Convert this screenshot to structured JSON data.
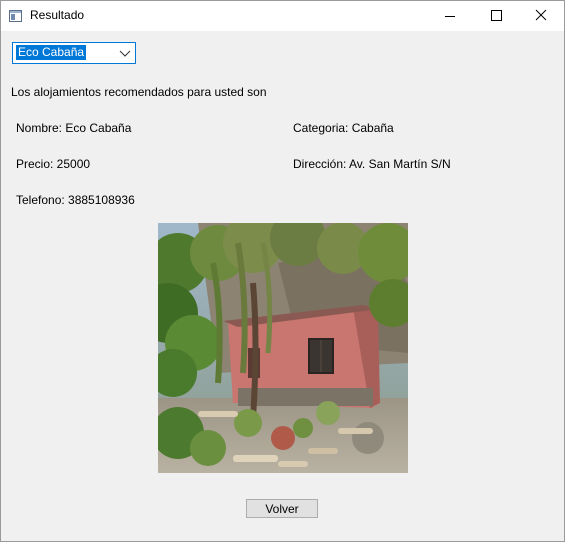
{
  "window": {
    "title": "Resultado",
    "icon": "window-app-icon",
    "controls": [
      "minimize-icon",
      "maximize-icon",
      "close-icon"
    ]
  },
  "selector": {
    "selected": "Eco Cabaña"
  },
  "intro_text": "Los alojamientos recomendados para usted son",
  "details": {
    "nombre": "Nombre: Eco Cabaña",
    "categoria": "Categoria: Cabaña",
    "precio": "Precio: 25000",
    "direccion": "Dirección: Av. San Martín S/N",
    "telefono": "Telefono: 3885108936"
  },
  "photo": {
    "subject": "pink adobe cabin among trees and garden"
  },
  "buttons": {
    "back": "Volver"
  },
  "colors": {
    "selection": "#0078d7",
    "background": "#f0f0f0",
    "button": "#e1e1e1"
  }
}
